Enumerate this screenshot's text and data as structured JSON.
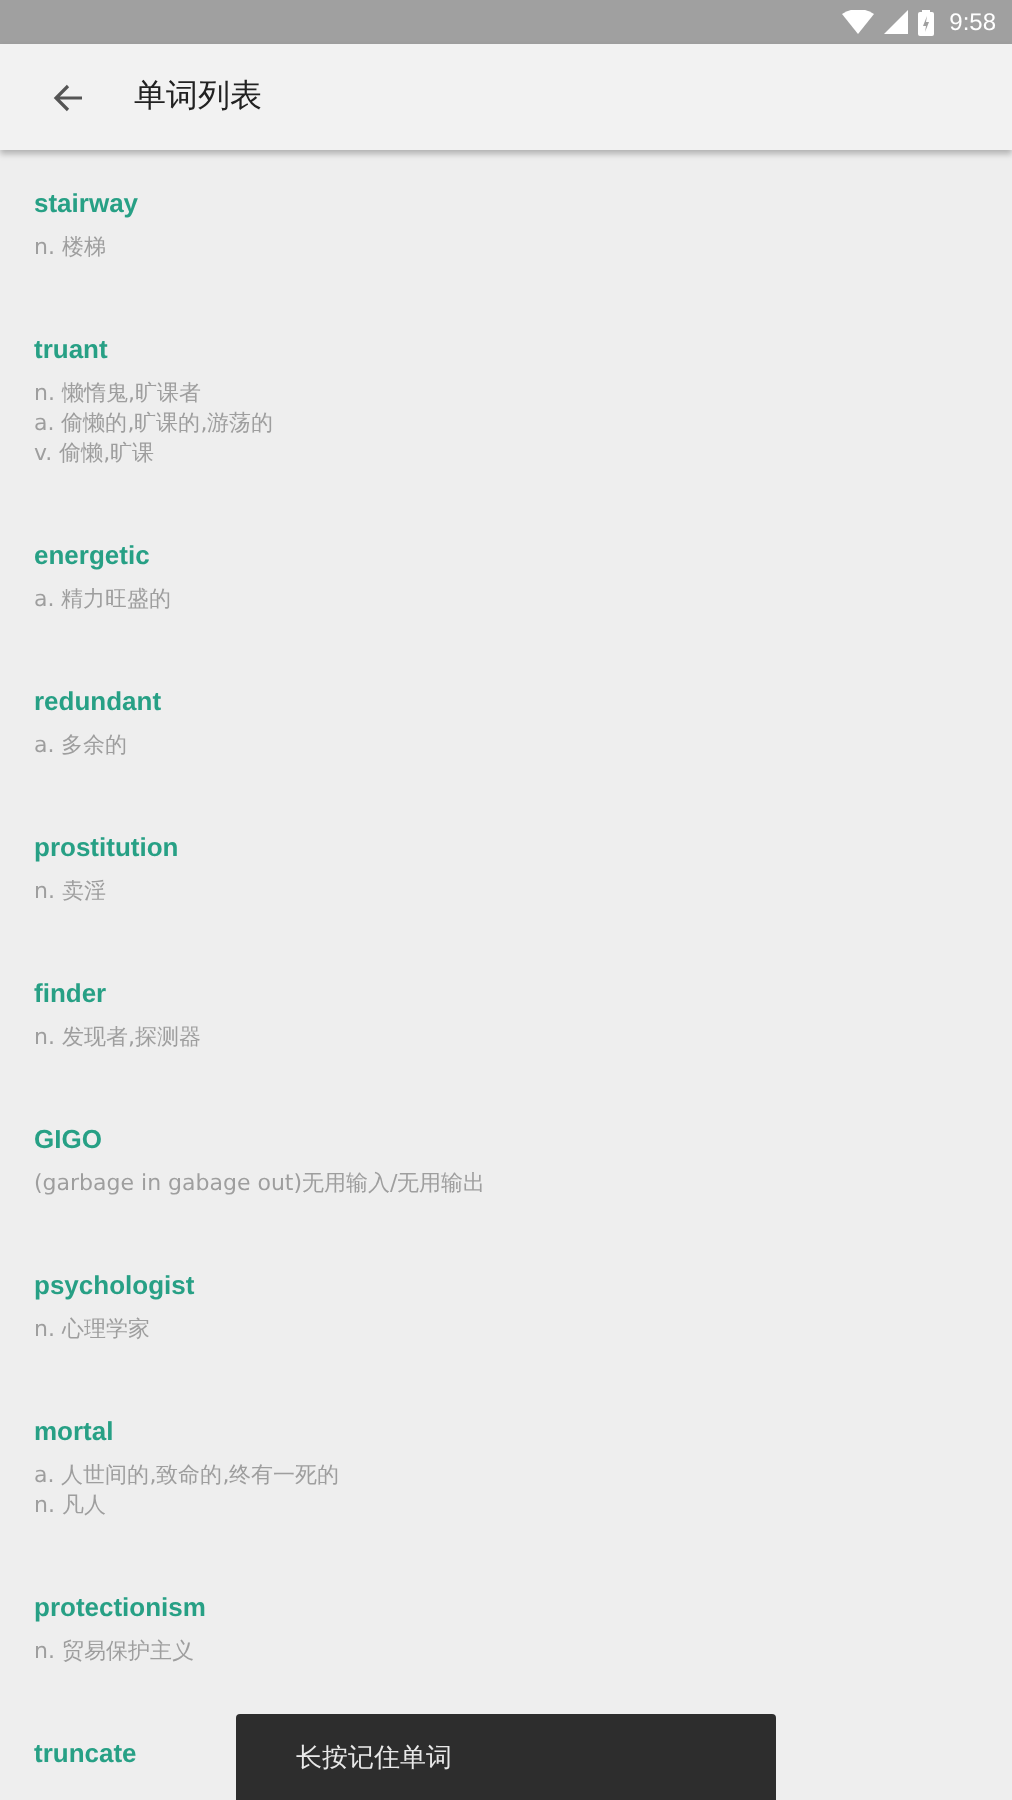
{
  "status_bar": {
    "time": "9:58"
  },
  "app_bar": {
    "title": "单词列表"
  },
  "words": [
    {
      "word": "stairway",
      "definitions": [
        "n. 楼梯"
      ]
    },
    {
      "word": "truant",
      "definitions": [
        "n. 懒惰鬼,旷课者",
        "a. 偷懒的,旷课的,游荡的",
        "v. 偷懒,旷课"
      ]
    },
    {
      "word": "energetic",
      "definitions": [
        "a. 精力旺盛的"
      ]
    },
    {
      "word": "redundant",
      "definitions": [
        "a. 多余的"
      ]
    },
    {
      "word": "prostitution",
      "definitions": [
        "n. 卖淫"
      ]
    },
    {
      "word": "finder",
      "definitions": [
        "n. 发现者,探测器"
      ]
    },
    {
      "word": "GIGO",
      "definitions": [
        "(garbage in gabage out)无用输入/无用输出"
      ]
    },
    {
      "word": "psychologist",
      "definitions": [
        "n. 心理学家"
      ]
    },
    {
      "word": "mortal",
      "definitions": [
        "a. 人世间的,致命的,终有一死的",
        "n. 凡人"
      ]
    },
    {
      "word": "protectionism",
      "definitions": [
        "n. 贸易保护主义"
      ]
    },
    {
      "word": "truncate"
    }
  ],
  "toast": {
    "text": "长按记住单词"
  }
}
